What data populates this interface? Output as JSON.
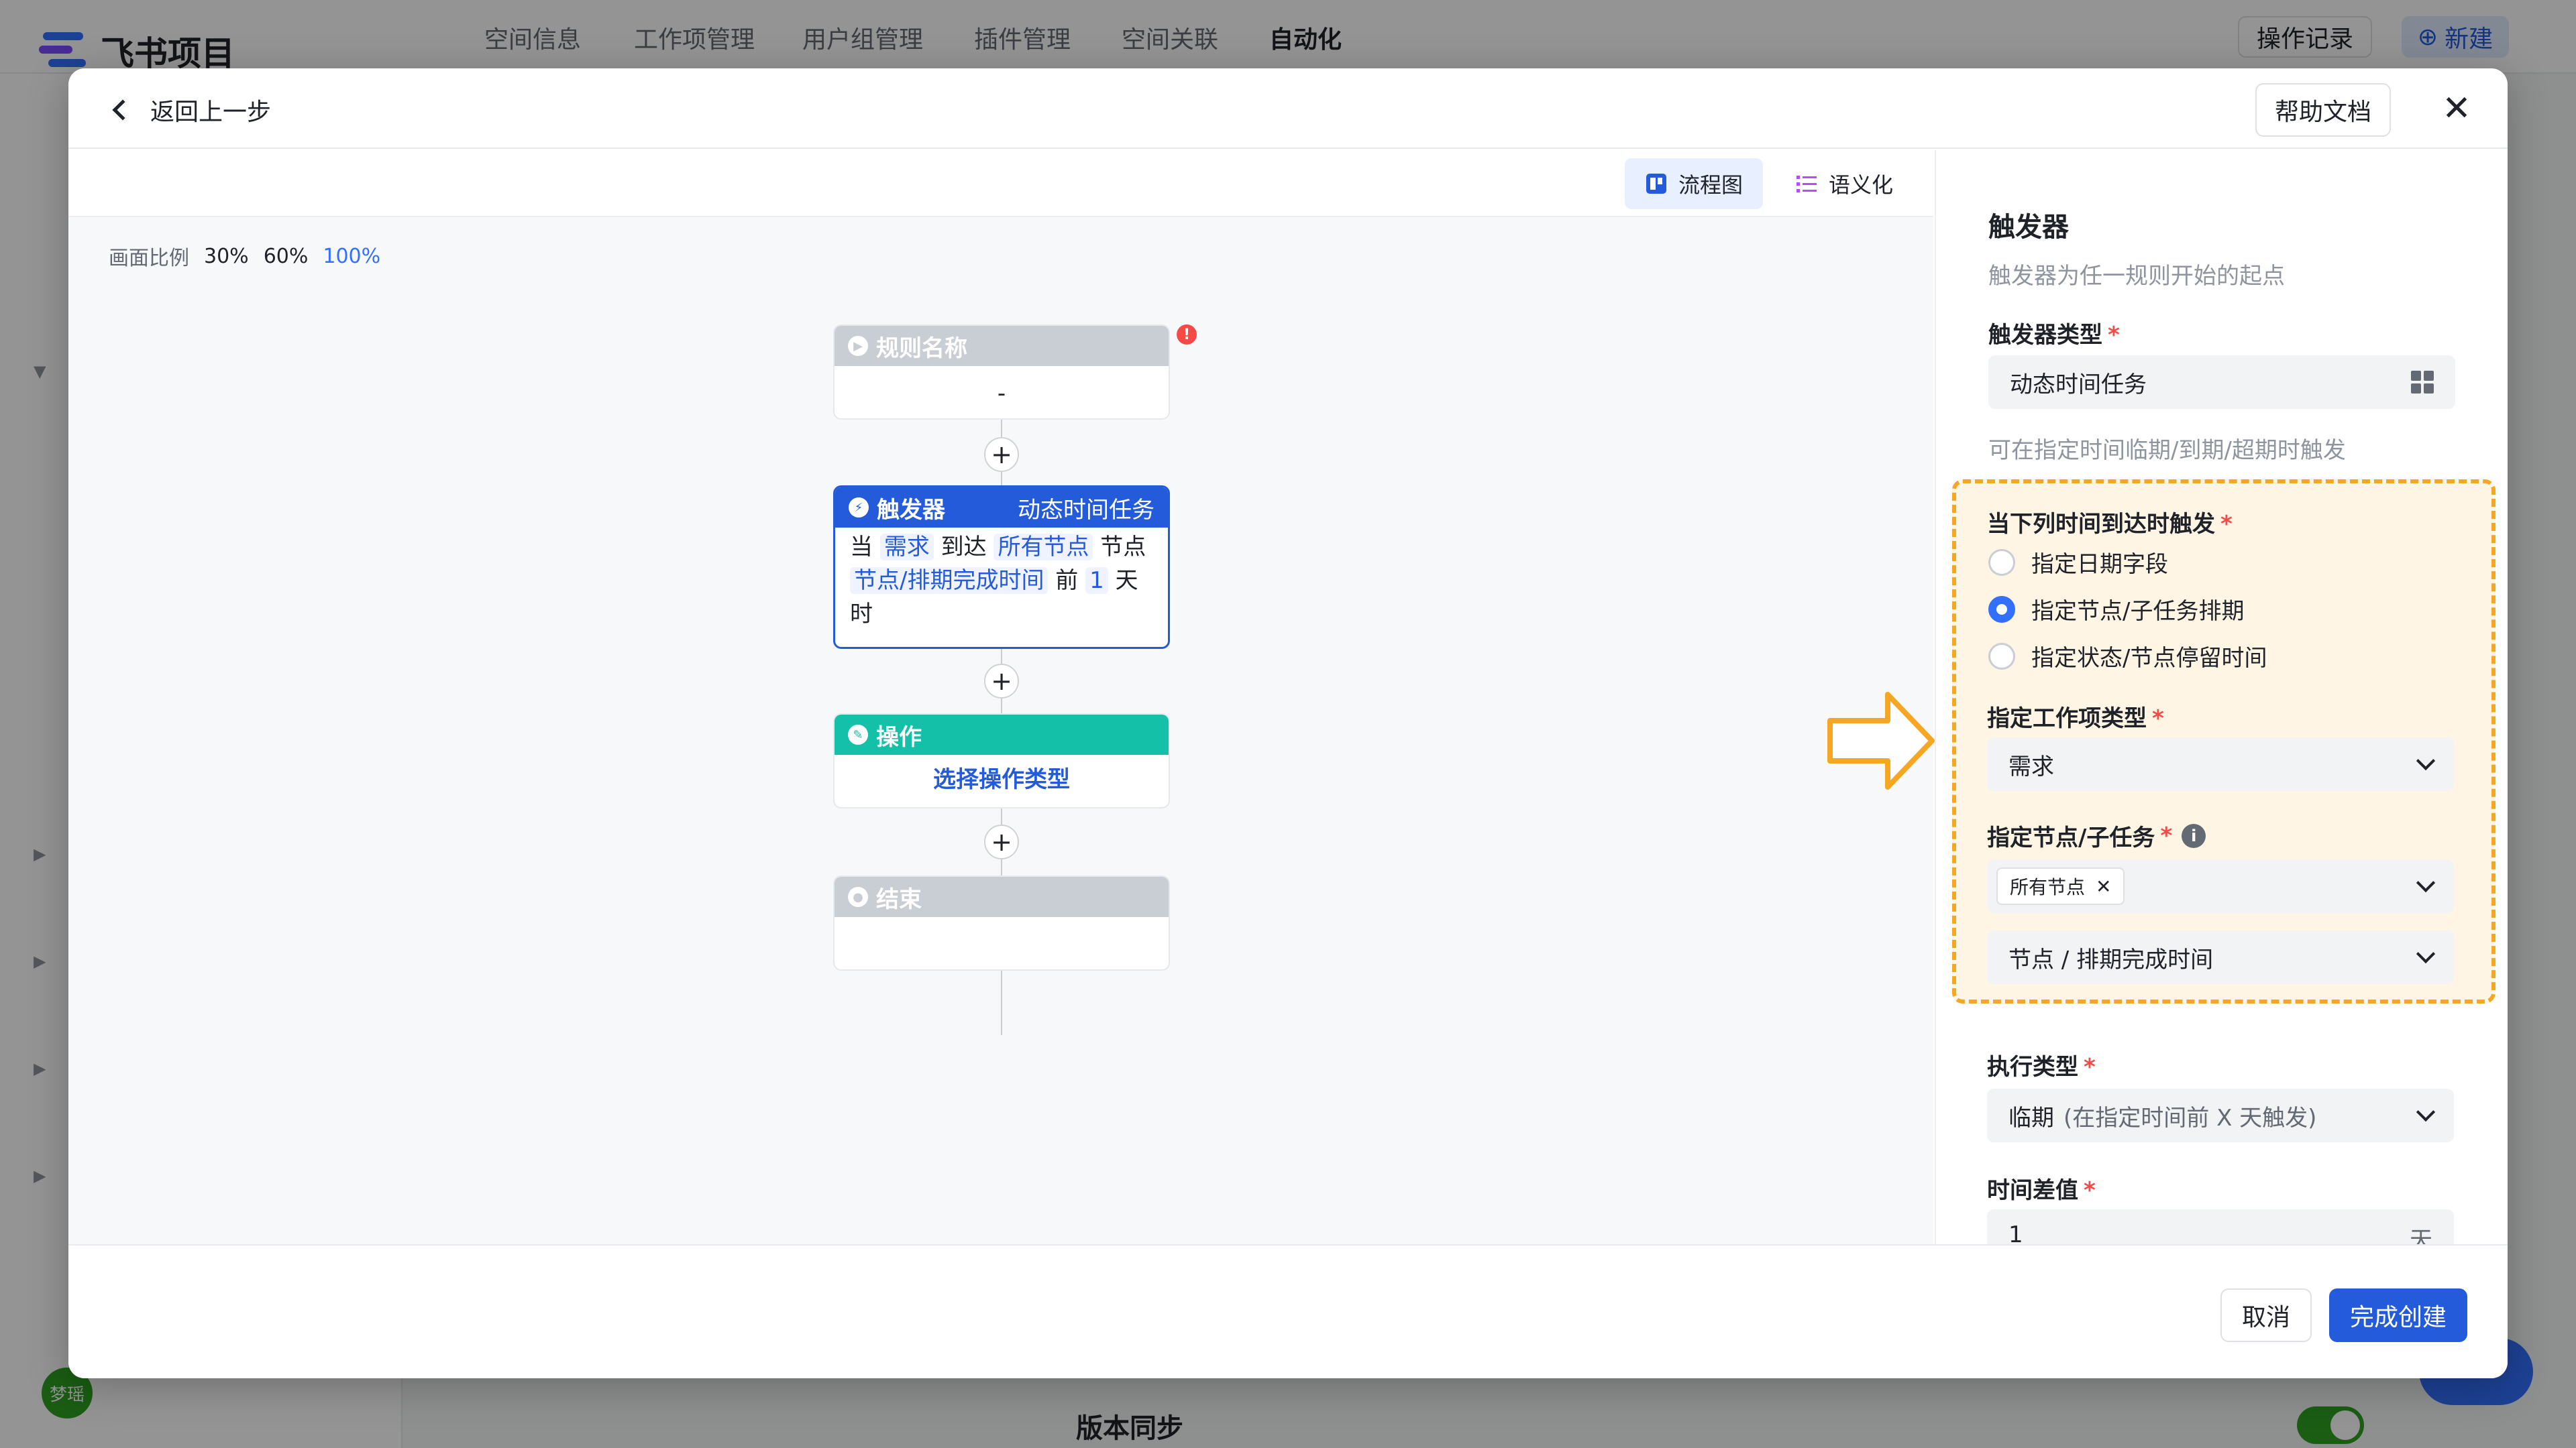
{
  "app": {
    "name": "飞书项目",
    "nav": [
      "空间信息",
      "工作项管理",
      "用户组管理",
      "插件管理",
      "空间关联",
      "自动化"
    ],
    "history_btn": "操作记录",
    "new_btn": "新建",
    "avatar_text": "梦瑶",
    "bottom_title": "版本同步"
  },
  "modal": {
    "back_label": "返回上一步",
    "help_label": "帮助文档",
    "view_tabs": [
      "流程图",
      "语义化"
    ],
    "zoom": {
      "label": "画面比例",
      "options": [
        "30%",
        "60%",
        "100%"
      ]
    },
    "flow": {
      "rule": {
        "title": "规则名称",
        "body": "-"
      },
      "trigger": {
        "title": "触发器",
        "type": "动态时间任务",
        "t1": "当",
        "c1": "需求",
        "t2": "到达",
        "c2": "所有节点",
        "t3": "节点",
        "c3": "节点/排期完成时间",
        "t4": "前",
        "c4": "1",
        "t5": "天",
        "t6": "时"
      },
      "action": {
        "title": "操作",
        "body": "选择操作类型"
      },
      "end": {
        "title": "结束"
      }
    },
    "panel": {
      "title": "触发器",
      "subtitle": "触发器为任一规则开始的起点",
      "trigger_type_label": "触发器类型",
      "trigger_type_value": "动态时间任务",
      "trigger_type_hint": "可在指定时间临期/到期/超期时触发",
      "when_label": "当下列时间到达时触发",
      "radio_options": [
        "指定日期字段",
        "指定节点/子任务排期",
        "指定状态/节点停留时间"
      ],
      "work_item_label": "指定工作项类型",
      "work_item_value": "需求",
      "node_label": "指定节点/子任务",
      "node_tag": "所有节点",
      "node_time_value": "节点 / 排期完成时间",
      "exec_label": "执行类型",
      "exec_value": "临期",
      "exec_hint": "(在指定时间前 X 天触发)",
      "diff_label": "时间差值",
      "diff_value": "1",
      "diff_unit": "天"
    },
    "footer": {
      "cancel": "取消",
      "create": "完成创建"
    }
  },
  "colors": {
    "accent": "#245bdb",
    "action": "#14c0a8",
    "highlight": "#f5a623",
    "error": "#f54a45"
  }
}
